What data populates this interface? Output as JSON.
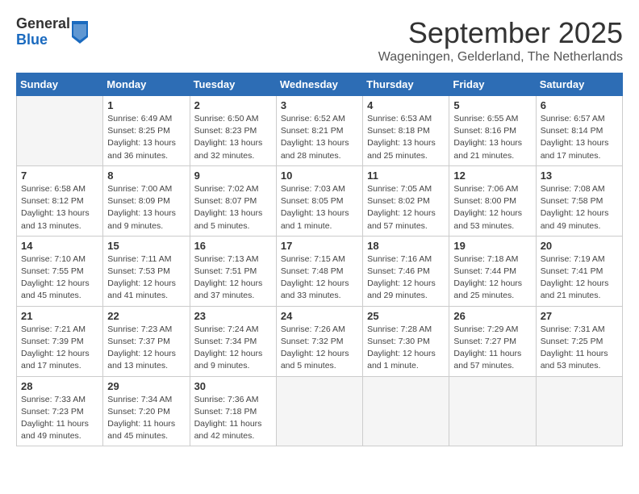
{
  "header": {
    "logo_general": "General",
    "logo_blue": "Blue",
    "month_title": "September 2025",
    "location": "Wageningen, Gelderland, The Netherlands"
  },
  "days_of_week": [
    "Sunday",
    "Monday",
    "Tuesday",
    "Wednesday",
    "Thursday",
    "Friday",
    "Saturday"
  ],
  "weeks": [
    [
      {
        "day": "",
        "info": ""
      },
      {
        "day": "1",
        "info": "Sunrise: 6:49 AM\nSunset: 8:25 PM\nDaylight: 13 hours\nand 36 minutes."
      },
      {
        "day": "2",
        "info": "Sunrise: 6:50 AM\nSunset: 8:23 PM\nDaylight: 13 hours\nand 32 minutes."
      },
      {
        "day": "3",
        "info": "Sunrise: 6:52 AM\nSunset: 8:21 PM\nDaylight: 13 hours\nand 28 minutes."
      },
      {
        "day": "4",
        "info": "Sunrise: 6:53 AM\nSunset: 8:18 PM\nDaylight: 13 hours\nand 25 minutes."
      },
      {
        "day": "5",
        "info": "Sunrise: 6:55 AM\nSunset: 8:16 PM\nDaylight: 13 hours\nand 21 minutes."
      },
      {
        "day": "6",
        "info": "Sunrise: 6:57 AM\nSunset: 8:14 PM\nDaylight: 13 hours\nand 17 minutes."
      }
    ],
    [
      {
        "day": "7",
        "info": "Sunrise: 6:58 AM\nSunset: 8:12 PM\nDaylight: 13 hours\nand 13 minutes."
      },
      {
        "day": "8",
        "info": "Sunrise: 7:00 AM\nSunset: 8:09 PM\nDaylight: 13 hours\nand 9 minutes."
      },
      {
        "day": "9",
        "info": "Sunrise: 7:02 AM\nSunset: 8:07 PM\nDaylight: 13 hours\nand 5 minutes."
      },
      {
        "day": "10",
        "info": "Sunrise: 7:03 AM\nSunset: 8:05 PM\nDaylight: 13 hours\nand 1 minute."
      },
      {
        "day": "11",
        "info": "Sunrise: 7:05 AM\nSunset: 8:02 PM\nDaylight: 12 hours\nand 57 minutes."
      },
      {
        "day": "12",
        "info": "Sunrise: 7:06 AM\nSunset: 8:00 PM\nDaylight: 12 hours\nand 53 minutes."
      },
      {
        "day": "13",
        "info": "Sunrise: 7:08 AM\nSunset: 7:58 PM\nDaylight: 12 hours\nand 49 minutes."
      }
    ],
    [
      {
        "day": "14",
        "info": "Sunrise: 7:10 AM\nSunset: 7:55 PM\nDaylight: 12 hours\nand 45 minutes."
      },
      {
        "day": "15",
        "info": "Sunrise: 7:11 AM\nSunset: 7:53 PM\nDaylight: 12 hours\nand 41 minutes."
      },
      {
        "day": "16",
        "info": "Sunrise: 7:13 AM\nSunset: 7:51 PM\nDaylight: 12 hours\nand 37 minutes."
      },
      {
        "day": "17",
        "info": "Sunrise: 7:15 AM\nSunset: 7:48 PM\nDaylight: 12 hours\nand 33 minutes."
      },
      {
        "day": "18",
        "info": "Sunrise: 7:16 AM\nSunset: 7:46 PM\nDaylight: 12 hours\nand 29 minutes."
      },
      {
        "day": "19",
        "info": "Sunrise: 7:18 AM\nSunset: 7:44 PM\nDaylight: 12 hours\nand 25 minutes."
      },
      {
        "day": "20",
        "info": "Sunrise: 7:19 AM\nSunset: 7:41 PM\nDaylight: 12 hours\nand 21 minutes."
      }
    ],
    [
      {
        "day": "21",
        "info": "Sunrise: 7:21 AM\nSunset: 7:39 PM\nDaylight: 12 hours\nand 17 minutes."
      },
      {
        "day": "22",
        "info": "Sunrise: 7:23 AM\nSunset: 7:37 PM\nDaylight: 12 hours\nand 13 minutes."
      },
      {
        "day": "23",
        "info": "Sunrise: 7:24 AM\nSunset: 7:34 PM\nDaylight: 12 hours\nand 9 minutes."
      },
      {
        "day": "24",
        "info": "Sunrise: 7:26 AM\nSunset: 7:32 PM\nDaylight: 12 hours\nand 5 minutes."
      },
      {
        "day": "25",
        "info": "Sunrise: 7:28 AM\nSunset: 7:30 PM\nDaylight: 12 hours\nand 1 minute."
      },
      {
        "day": "26",
        "info": "Sunrise: 7:29 AM\nSunset: 7:27 PM\nDaylight: 11 hours\nand 57 minutes."
      },
      {
        "day": "27",
        "info": "Sunrise: 7:31 AM\nSunset: 7:25 PM\nDaylight: 11 hours\nand 53 minutes."
      }
    ],
    [
      {
        "day": "28",
        "info": "Sunrise: 7:33 AM\nSunset: 7:23 PM\nDaylight: 11 hours\nand 49 minutes."
      },
      {
        "day": "29",
        "info": "Sunrise: 7:34 AM\nSunset: 7:20 PM\nDaylight: 11 hours\nand 45 minutes."
      },
      {
        "day": "30",
        "info": "Sunrise: 7:36 AM\nSunset: 7:18 PM\nDaylight: 11 hours\nand 42 minutes."
      },
      {
        "day": "",
        "info": ""
      },
      {
        "day": "",
        "info": ""
      },
      {
        "day": "",
        "info": ""
      },
      {
        "day": "",
        "info": ""
      }
    ]
  ]
}
